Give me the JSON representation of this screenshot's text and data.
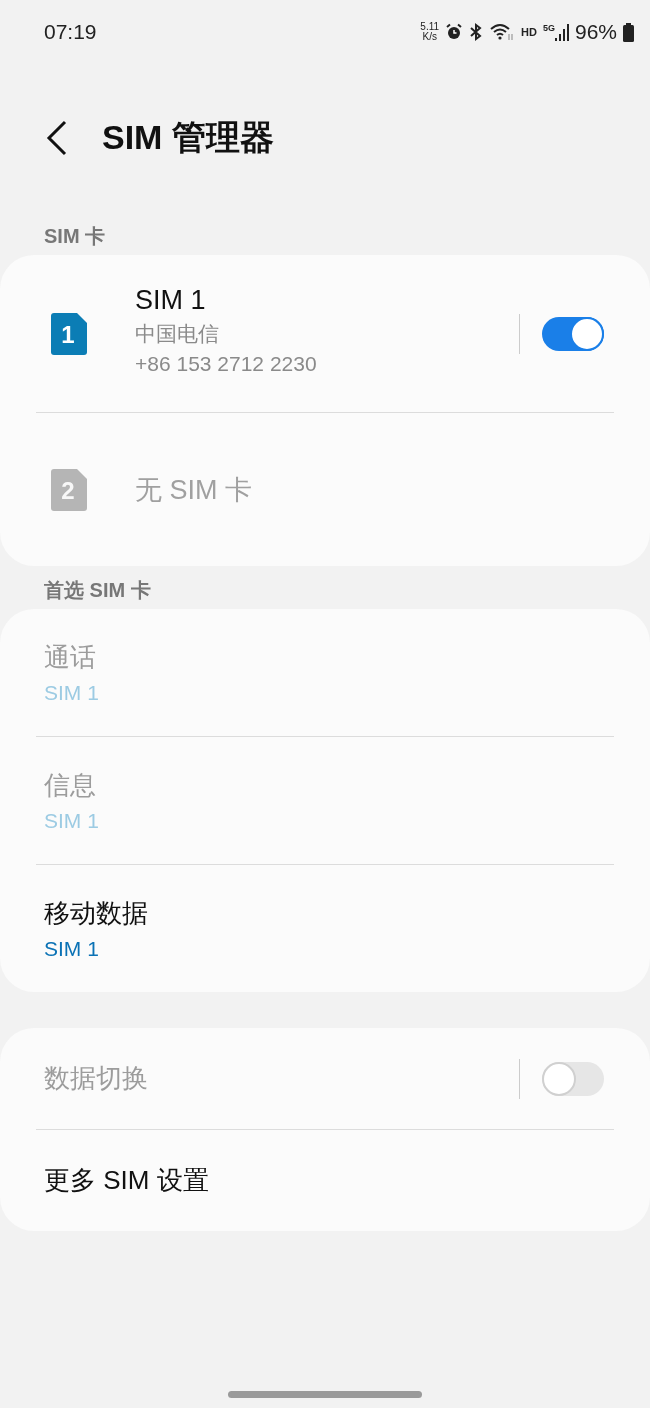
{
  "status_bar": {
    "time": "07:19",
    "speed_value": "5.11",
    "speed_unit": "K/s",
    "hd": "HD",
    "network": "5G",
    "battery": "96%"
  },
  "header": {
    "title": "SIM 管理器"
  },
  "sim_section": {
    "title": "SIM 卡",
    "cards": [
      {
        "kind": "inserted",
        "number": "1",
        "name": "SIM 1",
        "carrier": "中国电信",
        "phone": "+86 153 2712 2230",
        "disabled": false,
        "on": true
      },
      {
        "kind": "empty",
        "number": "2",
        "name": "无 SIM 卡",
        "disabled": true
      }
    ]
  },
  "preferred_section": {
    "title": "首选 SIM 卡",
    "items": [
      {
        "label": "通话",
        "value": "SIM 1",
        "disabled": true
      },
      {
        "label": "信息",
        "value": "SIM 1",
        "disabled": true
      },
      {
        "label": "移动数据",
        "value": "SIM 1",
        "disabled": false
      }
    ]
  },
  "more_section": {
    "items": [
      {
        "kind": "toggle",
        "label": "数据切换",
        "disabled": true,
        "on": false
      },
      {
        "kind": "link",
        "label": "更多 SIM 设置",
        "disabled": false
      }
    ]
  }
}
